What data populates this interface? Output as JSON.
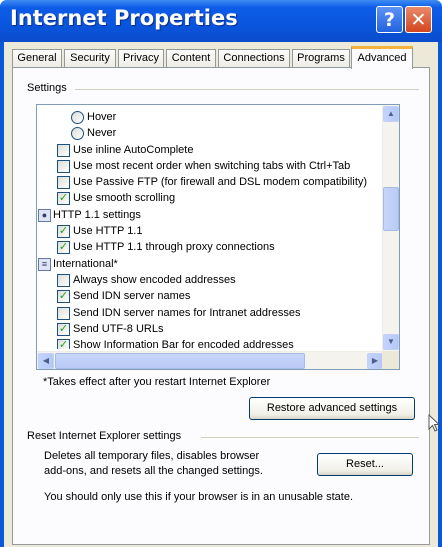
{
  "window": {
    "title": "Internet Properties",
    "help_glyph": "?",
    "close_glyph": "✕"
  },
  "tabs": [
    {
      "label": "General",
      "active": false
    },
    {
      "label": "Security",
      "active": false
    },
    {
      "label": "Privacy",
      "active": false
    },
    {
      "label": "Content",
      "active": false
    },
    {
      "label": "Connections",
      "active": false
    },
    {
      "label": "Programs",
      "active": false
    },
    {
      "label": "Advanced",
      "active": true
    }
  ],
  "settings": {
    "label": "Settings",
    "items": [
      {
        "type": "radio",
        "label": "Hover",
        "checked": false
      },
      {
        "type": "radio",
        "label": "Never",
        "checked": false
      },
      {
        "type": "checkbox",
        "label": "Use inline AutoComplete",
        "checked": false
      },
      {
        "type": "checkbox",
        "label": "Use most recent order when switching tabs with Ctrl+Tab",
        "checked": false
      },
      {
        "type": "checkbox",
        "label": "Use Passive FTP (for firewall and DSL modem compatibility)",
        "checked": false
      },
      {
        "type": "checkbox",
        "label": "Use smooth scrolling",
        "checked": true
      },
      {
        "type": "category",
        "label": "HTTP 1.1 settings",
        "icon": "globe-settings-icon"
      },
      {
        "type": "checkbox",
        "label": "Use HTTP 1.1",
        "checked": true
      },
      {
        "type": "checkbox",
        "label": "Use HTTP 1.1 through proxy connections",
        "checked": true
      },
      {
        "type": "category",
        "label": "International*",
        "icon": "international-settings-icon"
      },
      {
        "type": "checkbox",
        "label": "Always show encoded addresses",
        "checked": false
      },
      {
        "type": "checkbox",
        "label": "Send IDN server names",
        "checked": true
      },
      {
        "type": "checkbox",
        "label": "Send IDN server names for Intranet addresses",
        "checked": false
      },
      {
        "type": "checkbox",
        "label": "Send UTF-8 URLs",
        "checked": true
      },
      {
        "type": "checkbox",
        "label": "Show Information Bar for encoded addresses",
        "checked": true
      }
    ],
    "scroll_up_glyph": "▲",
    "scroll_down_glyph": "▼",
    "scroll_left_glyph": "◀",
    "scroll_right_glyph": "▶"
  },
  "note": "*Takes effect after you restart Internet Explorer",
  "restore_button": "Restore advanced settings",
  "reset": {
    "title": "Reset Internet Explorer settings",
    "description": "Deletes all temporary files, disables browser add-ons, and resets all the changed settings.",
    "button": "Reset...",
    "warning": "You should only use this if your browser is in an unusable state."
  },
  "colors": {
    "titlebar": "#0a55dd",
    "dialog_face": "#ece9d8",
    "active_tab_accent": "#f3b43d",
    "check_mark": "#21a121"
  }
}
